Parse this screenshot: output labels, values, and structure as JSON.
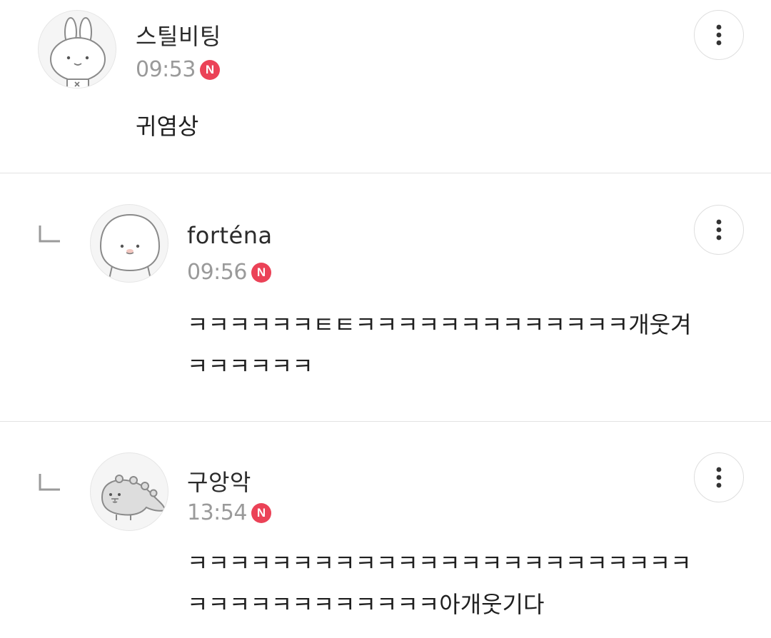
{
  "comments": [
    {
      "author": "스틸비팅",
      "time": "09:53",
      "new_badge": "N",
      "text": "귀염상",
      "is_reply": false,
      "avatar_icon": "bunny-avatar-icon",
      "more_icon": "more-vertical-icon"
    },
    {
      "author": "forténa",
      "time": "09:56",
      "new_badge": "N",
      "text": "ㅋㅋㅋㅋㅋㅋㅌㅌㅋㅋㅋㅋㅋㅋㅋㅋㅋㅋㅋㅋㅋ개웃겨 ㅋㅋㅋㅋㅋㅋ",
      "is_reply": true,
      "reply_icon": "reply-arrow-icon",
      "avatar_icon": "seal-avatar-icon",
      "more_icon": "more-vertical-icon"
    },
    {
      "author": "구앙악",
      "time": "13:54",
      "new_badge": "N",
      "text": "ㅋㅋㅋㅋㅋㅋㅋㅋㅋㅋㅋㅋㅋㅋㅋㅋㅋㅋㅋㅋㅋㅋㅋㅋㅋㅋㅋㅋㅋㅋㅋㅋㅋㅋㅋㅋ아개웃기다",
      "is_reply": true,
      "reply_icon": "reply-arrow-icon",
      "avatar_icon": "dinosaur-avatar-icon",
      "more_icon": "more-vertical-icon"
    }
  ],
  "colors": {
    "background": "#ffffff",
    "divider": "#e2e2e2",
    "time_text": "#9a9a9a",
    "new_badge": "#eb4257",
    "author_text": "#2b2b2b",
    "body_text": "#1f1f1f"
  }
}
